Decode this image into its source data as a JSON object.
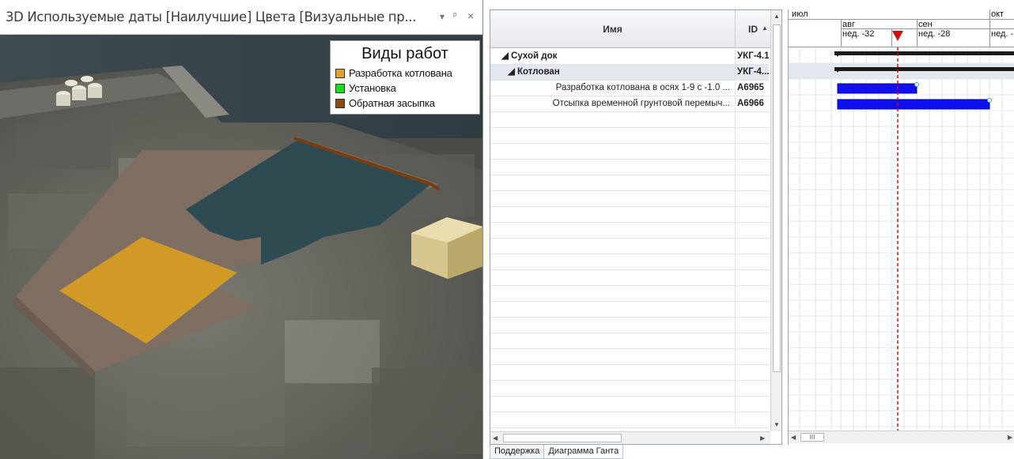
{
  "viewport": {
    "title": "3D Используемые даты [Наилучшие] Цвета [Визуальные пр...",
    "menu_icon": "dropdown-arrow-icon",
    "pin_icon": "pin-icon",
    "close_icon": "close-icon"
  },
  "legend": {
    "title": "Виды работ",
    "items": [
      {
        "label": "Разработка котлована",
        "color": "#e0a22a"
      },
      {
        "label": "Установка",
        "color": "#19e01f"
      },
      {
        "label": "Обратная засыпка",
        "color": "#8b4a12"
      }
    ]
  },
  "grid": {
    "col_name": "Имя",
    "col_id": "ID",
    "rows": [
      {
        "name": "◢ Сухой док",
        "id": "УКГ-4.1",
        "level": 0,
        "bold": true
      },
      {
        "name": "◢ Котлован",
        "id": "УКГ-4...",
        "level": 1,
        "bold": true,
        "selected": true
      },
      {
        "name": "Разработка котлована в осях 1-9 с -1.0 ...",
        "id": "А6965",
        "level": 2,
        "bold": false
      },
      {
        "name": "Отсыпка временной грунтовой перемыч...",
        "id": "А6966",
        "level": 2,
        "bold": false
      }
    ]
  },
  "tabs": [
    "Поддержка",
    "Диаграмма Ганта"
  ],
  "gantt": {
    "months": [
      "июл",
      "авг",
      "сен",
      "окт"
    ],
    "weeks": [
      "нед. -32",
      "нед. -28",
      "нед. -"
    ],
    "bar_color": "#1010ee",
    "summary_color": "#1a1a1a",
    "marker_color": "#cc1111",
    "scroll_label": "III"
  }
}
